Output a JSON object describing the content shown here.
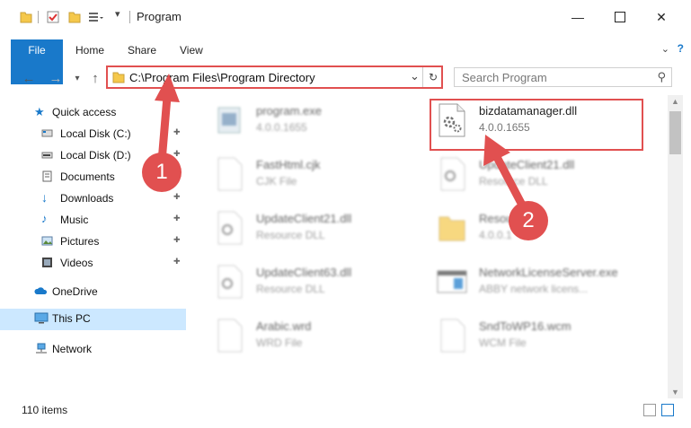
{
  "window": {
    "title": "Program"
  },
  "ribbon": {
    "tabs": [
      "File",
      "Home",
      "Share",
      "View"
    ]
  },
  "address": {
    "path": "C:\\Program Files\\Program Directory"
  },
  "search": {
    "placeholder": "Search Program"
  },
  "sidebar": {
    "quick_access": "Quick access",
    "pinned": [
      {
        "label": "Local Disk (C:)",
        "icon": "drive-icon"
      },
      {
        "label": "Local Disk (D:)",
        "icon": "drive-icon"
      },
      {
        "label": "Documents",
        "icon": "documents-icon"
      },
      {
        "label": "Downloads",
        "icon": "downloads-icon"
      },
      {
        "label": "Music",
        "icon": "music-icon"
      },
      {
        "label": "Pictures",
        "icon": "pictures-icon"
      },
      {
        "label": "Videos",
        "icon": "videos-icon"
      }
    ],
    "onedrive": "OneDrive",
    "thispc": "This PC",
    "network": "Network"
  },
  "files": [
    {
      "name": "program.exe",
      "sub": "4.0.0.1655",
      "icon": "exe-icon"
    },
    {
      "name": "bizdatamanager.dll",
      "sub": "4.0.0.1655",
      "icon": "dll-gear-icon"
    },
    {
      "name": "FastHtml.cjk",
      "sub": "CJK File",
      "icon": "blank-file-icon"
    },
    {
      "name": "UpdateClient21.dll",
      "sub": "Resource DLL",
      "icon": "dll-gear-icon"
    },
    {
      "name": "UpdateClient21.dll",
      "sub": "Resource DLL",
      "icon": "dll-gear-icon"
    },
    {
      "name": "Resou",
      "sub": "4.0.0.1",
      "icon": "folder-icon"
    },
    {
      "name": "UpdateClient63.dll",
      "sub": "Resource DLL",
      "icon": "dll-gear-icon"
    },
    {
      "name": "NetworkLicenseServer.exe",
      "sub": "ABBY network licens...",
      "icon": "exe-window-icon"
    },
    {
      "name": "Arabic.wrd",
      "sub": "WRD File",
      "icon": "blank-file-icon"
    },
    {
      "name": "SndToWP16.wcm",
      "sub": "WCM File",
      "icon": "blank-file-icon"
    }
  ],
  "status": {
    "count": "110 items"
  },
  "annotations": {
    "badge1": "1",
    "badge2": "2"
  },
  "colors": {
    "accent": "#1979ca",
    "highlight": "#e15050",
    "selected": "#cce8ff"
  }
}
